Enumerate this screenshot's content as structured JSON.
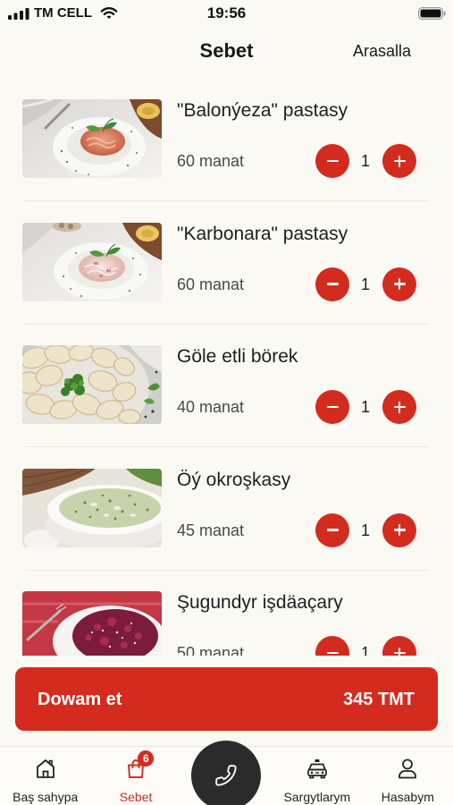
{
  "status_bar": {
    "carrier": "TM CELL",
    "time": "19:56",
    "icons": [
      "signal-icon",
      "wifi-icon",
      "battery-icon"
    ]
  },
  "header": {
    "title": "Sebet",
    "clear_label": "Arasalla"
  },
  "cart": {
    "items": [
      {
        "name": "\"Balonýeza\" pastasy",
        "price": "60 manat",
        "quantity": "1"
      },
      {
        "name": "\"Karbonara\" pastasy",
        "price": "60 manat",
        "quantity": "1"
      },
      {
        "name": "Göle etli börek",
        "price": "40 manat",
        "quantity": "1"
      },
      {
        "name": "Öý okroşkasy",
        "price": "45 manat",
        "quantity": "1"
      },
      {
        "name": "Şugundyr işdäaçary",
        "price": "50 manat",
        "quantity": "1"
      }
    ],
    "decrement_icon": "minus-icon",
    "increment_icon": "plus-icon"
  },
  "checkout": {
    "label": "Dowam et",
    "total": "345 TMT"
  },
  "tab_bar": {
    "items": [
      {
        "label": "Baş sahypa",
        "icon": "home-icon"
      },
      {
        "label": "Sebet",
        "icon": "bag-icon",
        "badge": "6",
        "active": true
      },
      {
        "label": "Sargytlarym",
        "icon": "taxi-icon"
      },
      {
        "label": "Hasabym",
        "icon": "user-icon"
      }
    ],
    "call_button": {
      "icon": "phone-icon"
    }
  },
  "colors": {
    "accent": "#d42b1f",
    "background": "#fbf9f3",
    "call_button": "#2b2b2b"
  }
}
